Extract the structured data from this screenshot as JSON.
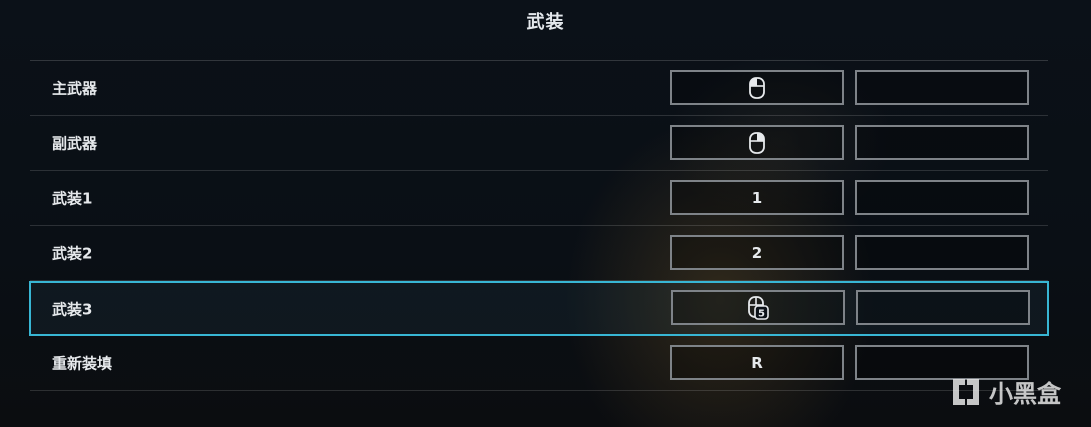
{
  "section": {
    "title": "武装"
  },
  "bindings": [
    {
      "label": "主武器",
      "primary_icon": "mouse-left-click-icon",
      "primary_text": "",
      "secondary_text": ""
    },
    {
      "label": "副武器",
      "primary_icon": "mouse-right-click-icon",
      "primary_text": "",
      "secondary_text": ""
    },
    {
      "label": "武装1",
      "primary_icon": "",
      "primary_text": "1",
      "secondary_text": ""
    },
    {
      "label": "武装2",
      "primary_icon": "",
      "primary_text": "2",
      "secondary_text": ""
    },
    {
      "label": "武装3",
      "primary_icon": "mouse-button-5-icon",
      "primary_text": "",
      "secondary_text": "",
      "selected": true
    },
    {
      "label": "重新装填",
      "primary_icon": "",
      "primary_text": "R",
      "secondary_text": ""
    }
  ],
  "mouse_button_5_label": "5",
  "watermark": {
    "text": "小黑盒",
    "icon": "xiaoheihe-logo-icon"
  },
  "colors": {
    "selection": "#38b6d4",
    "slot_border": "#7e8388",
    "background": "#0a0f16"
  }
}
